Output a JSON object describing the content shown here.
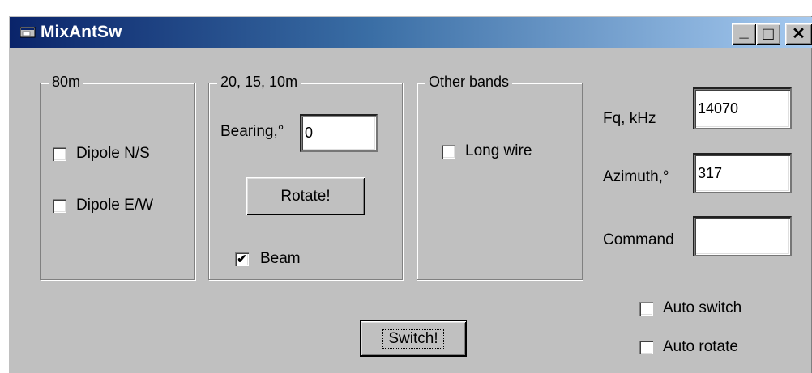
{
  "window": {
    "title": "MixAntSw",
    "controls": {
      "minimize": "_",
      "maximize": "□",
      "close": "✕"
    },
    "icon": "app-window-icon"
  },
  "group_80m": {
    "caption": "80m",
    "checkboxes": [
      {
        "label": "Dipole N/S",
        "checked": false
      },
      {
        "label": "Dipole E/W",
        "checked": false
      }
    ]
  },
  "group_hf": {
    "caption": "20, 15, 10m",
    "bearing_label": "Bearing,°",
    "bearing_value": "0",
    "rotate_label": "Rotate!",
    "beam": {
      "label": "Beam",
      "checked": true
    }
  },
  "group_other": {
    "caption": "Other bands",
    "longwire": {
      "label": "Long wire",
      "checked": false
    }
  },
  "right_panel": {
    "fq_label": "Fq, kHz",
    "fq_value": "14070",
    "azimuth_label": "Azimuth,°",
    "azimuth_value": "317",
    "command_label": "Command",
    "command_value": "",
    "auto_switch": {
      "label": "Auto switch",
      "checked": false
    },
    "auto_rotate": {
      "label": "Auto rotate",
      "checked": false
    }
  },
  "switch_label": "Switch!",
  "colors": {
    "face": "#c0c0c0",
    "title_start": "#0a246a",
    "title_end": "#a6caf0"
  }
}
